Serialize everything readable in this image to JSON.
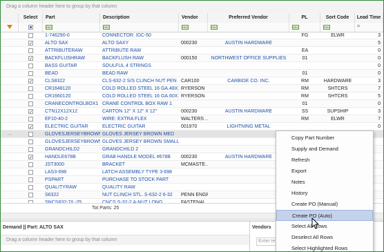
{
  "group_bar": {
    "text": "Drag a column header here to group by that column"
  },
  "columns": {
    "select": "Select",
    "part": "Part",
    "description": "Description",
    "vendor": "Vendor",
    "preferred_vendor": "Preferred Vendor",
    "pl": "PL",
    "sort_code": "Sort Code",
    "lead_time": "Lead Time"
  },
  "rows": [
    {
      "checked": false,
      "part": "1-746290-0",
      "description": "CONNECTOR: IDC-50",
      "vendor": "",
      "preferred_vendor": "",
      "pl": "FG",
      "sort_code": "ELWR",
      "lead_time": "3"
    },
    {
      "checked": true,
      "part": "ALTO SAX",
      "description": "ALTO SAXY",
      "vendor": "000230",
      "preferred_vendor": "AUSTIN HARDWARE",
      "pl": "",
      "sort_code": "",
      "lead_time": "5"
    },
    {
      "checked": false,
      "part": "ATTRIBUTERAW",
      "description": "ATTRIBUTE RAW",
      "vendor": "",
      "preferred_vendor": "",
      "pl": "EA",
      "sort_code": "",
      "lead_time": "0"
    },
    {
      "checked": true,
      "part": "BACKFLUSHRAW",
      "description": "BACKFLUSH RAW",
      "vendor": "000150",
      "preferred_vendor": "NORTHWEST OFFICE SUPPLIES",
      "pl": "01",
      "sort_code": "",
      "lead_time": "0"
    },
    {
      "checked": false,
      "part": "BASS GUITAR",
      "description": "SOULFUL 4 STRINGS",
      "vendor": "",
      "preferred_vendor": "",
      "pl": "",
      "sort_code": "",
      "lead_time": "0"
    },
    {
      "checked": false,
      "part": "BEAD",
      "description": "BEAD RAW",
      "vendor": "",
      "preferred_vendor": "",
      "pl": "01",
      "sort_code": "",
      "lead_time": "0"
    },
    {
      "checked": true,
      "part": "CLS8322",
      "description": "CLS-832-2 S/S CLINCH NUT PEN",
      "vendor": "CAR100",
      "preferred_vendor": "CARBIDE CO. INC.",
      "pl": "RM",
      "sort_code": "HARDWARE",
      "lead_time": "3"
    },
    {
      "checked": false,
      "part": "CR1648120",
      "description": "COLD ROLLED STEEL 16 GA.48X120",
      "vendor": "RYERSON",
      "preferred_vendor": "",
      "pl": "RM",
      "sort_code": "SHTCRS",
      "lead_time": "7"
    },
    {
      "checked": false,
      "part": "CR1660120",
      "description": "COLD ROLLED STEEL 16 GA.60X120",
      "vendor": "RYERSON",
      "preferred_vendor": "",
      "pl": "RM",
      "sort_code": "SHTCRS",
      "lead_time": "5"
    },
    {
      "checked": false,
      "part": "CRANECONTROLBOX1",
      "description": "CRANE CONTROL BOX RAW 1",
      "vendor": "",
      "preferred_vendor": "",
      "pl": "01",
      "sort_code": "",
      "lead_time": "0"
    },
    {
      "checked": true,
      "part": "CTN12X12X12",
      "description": "CARTON 12\" X 12\" X 12\"",
      "vendor": "000230",
      "preferred_vendor": "AUSTIN HARDWARE",
      "pl": "SS",
      "sort_code": "SUPSHIP",
      "lead_time": "3"
    },
    {
      "checked": false,
      "part": "EF10-40-2",
      "description": "WIRE: EXTRA FLEX",
      "vendor": "WALTERS ...",
      "preferred_vendor": "",
      "pl": "RM",
      "sort_code": "ELWR",
      "lead_time": "7"
    },
    {
      "checked": true,
      "part": "ELECTRIC GUITAR",
      "description": "ELECTRIC GUITAR",
      "vendor": "001970",
      "preferred_vendor": "LIGHTNING METAL",
      "pl": "",
      "sort_code": "",
      "lead_time": "0"
    },
    {
      "checked": false,
      "part": "GLOVESJERSEYBROWN...",
      "description": "GLOVES JERSEY BROWN MED",
      "vendor": "",
      "preferred_vendor": "",
      "pl": "",
      "sort_code": "",
      "lead_time": "",
      "current": true
    },
    {
      "checked": false,
      "part": "GLOVESJERSEYBROWNS...",
      "description": "GLOVES JERSEY BROWN SMALL",
      "vendor": "",
      "preferred_vendor": "",
      "pl": "",
      "sort_code": "",
      "lead_time": ""
    },
    {
      "checked": false,
      "part": "GRANDCHILD2",
      "description": "GRANDCHILD 2",
      "vendor": "",
      "preferred_vendor": "",
      "pl": "",
      "sort_code": "",
      "lead_time": ""
    },
    {
      "checked": true,
      "part": "HANDLE678B",
      "description": "GRAB HANDLE MODEL #678B",
      "vendor": "000230",
      "preferred_vendor": "AUSTIN HARDWARE",
      "pl": "",
      "sort_code": "",
      "lead_time": ""
    },
    {
      "checked": false,
      "part": "JST3000",
      "description": "BRACKET",
      "vendor": "MCMASTE...",
      "preferred_vendor": "",
      "pl": "",
      "sort_code": "",
      "lead_time": ""
    },
    {
      "checked": false,
      "part": "LAS3-698",
      "description": "LATCH ASSEMBLY TYPE 3-698",
      "vendor": "",
      "preferred_vendor": "",
      "pl": "",
      "sort_code": "",
      "lead_time": ""
    },
    {
      "checked": false,
      "part": "PSPART",
      "description": "PURCHASE TO STOCK PART",
      "vendor": "",
      "preferred_vendor": "",
      "pl": "",
      "sort_code": "",
      "lead_time": ""
    },
    {
      "checked": false,
      "part": "QUALITYRAW",
      "description": "QUALITY RAW",
      "vendor": "",
      "preferred_vendor": "",
      "pl": "",
      "sort_code": "",
      "lead_time": ""
    },
    {
      "checked": false,
      "part": "S6322",
      "description": "NUT CLINCH STL. S-632-2 6-32",
      "vendor": "PENN ENGR",
      "preferred_vendor": "",
      "pl": "",
      "sort_code": "",
      "lead_time": ""
    },
    {
      "checked": false,
      "part": "SNCS832-7/L-25",
      "description": "CNCS S-32-2 A-NUT LONG",
      "vendor": "FASTENAL",
      "preferred_vendor": "",
      "pl": "",
      "sort_code": "",
      "lead_time": ""
    }
  ],
  "totals": {
    "text": "Tot Parts: 25"
  },
  "bottom": {
    "demand_title": "Demand || Part: ALTO SAX",
    "demand_group_bar": "Drag a column header here to group by that column",
    "vendors_title": "Vendors",
    "vendors_filter_placeholder": "Enter tex"
  },
  "context_menu": [
    "Copy Part Number",
    "Supply and Demand",
    "Refresh",
    "Export",
    "Notes",
    "History",
    "Create PO (Manual)",
    "Create PO (Auto)",
    "Select All Rows",
    "Deselect All Rows",
    "Select Highlighted Rows"
  ],
  "context_menu_active_index": 7,
  "colors": {
    "link_blue": "#1e4fa8",
    "menu_highlight": "#c4d2ec",
    "filter_icon": "#e07a1a",
    "frame_border": "#2f8a3a"
  }
}
